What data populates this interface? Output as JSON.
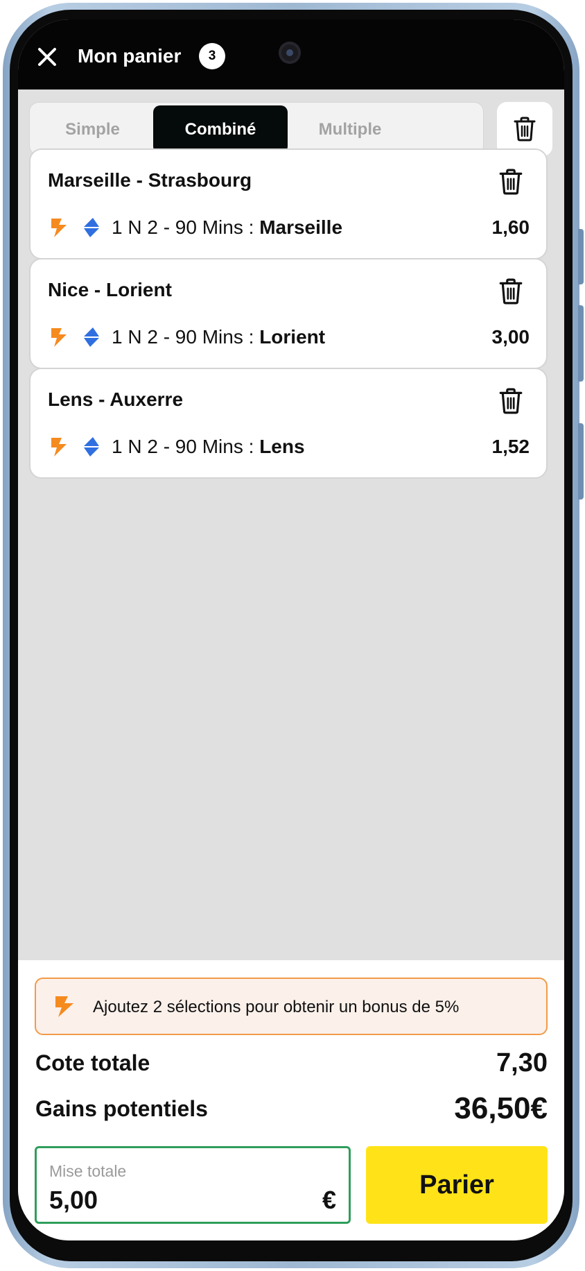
{
  "header": {
    "title": "Mon panier",
    "badge_count": "3"
  },
  "tabs": [
    {
      "label": "Simple",
      "active": false
    },
    {
      "label": "Combiné",
      "active": true
    },
    {
      "label": "Multiple",
      "active": false
    }
  ],
  "bets": [
    {
      "match": "Marseille - Strasbourg",
      "market": "1 N 2 - 90 Mins : ",
      "selection": "Marseille",
      "odds": "1,60"
    },
    {
      "match": "Nice - Lorient",
      "market": "1 N 2 - 90 Mins : ",
      "selection": "Lorient",
      "odds": "3,00"
    },
    {
      "match": "Lens - Auxerre",
      "market": "1 N 2 - 90 Mins : ",
      "selection": "Lens",
      "odds": "1,52"
    }
  ],
  "summary": {
    "bonus_message": "Ajoutez 2 sélections pour obtenir un bonus de 5%",
    "total_odds_label": "Cote totale",
    "total_odds_value": "7,30",
    "potential_gains_label": "Gains potentiels",
    "potential_gains_value": "36,50€",
    "stake_label": "Mise totale",
    "stake_value": "5,00",
    "stake_currency": "€",
    "bet_button_label": "Parier"
  },
  "colors": {
    "accent_yellow": "#ffe318",
    "bolt_orange": "#f58a1f",
    "boost_blue": "#2f6fe0",
    "stake_border_green": "#2f9e5b",
    "banner_border": "#f29a48"
  },
  "icons": [
    "close-icon",
    "trash-icon",
    "lightning-icon",
    "boost-icon"
  ]
}
